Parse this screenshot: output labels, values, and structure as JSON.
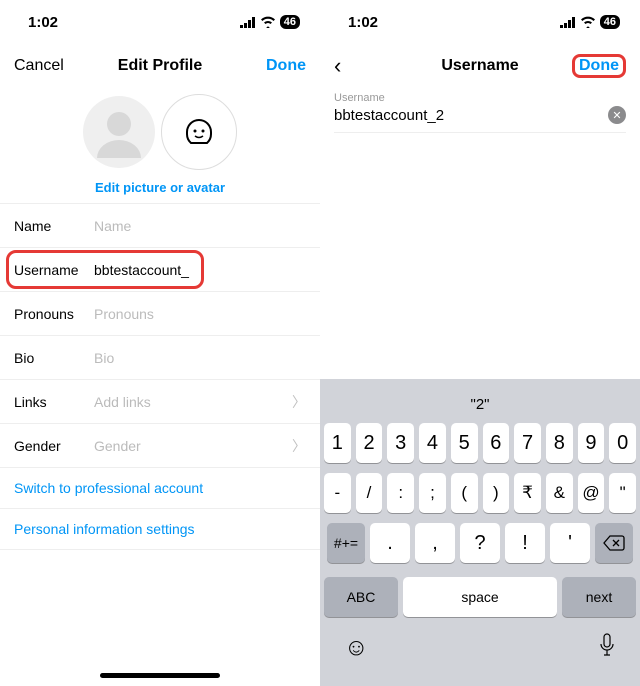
{
  "status": {
    "time": "1:02",
    "battery": "46"
  },
  "left": {
    "nav": {
      "cancel": "Cancel",
      "title": "Edit Profile",
      "done": "Done"
    },
    "editLink": "Edit picture or avatar",
    "rows": {
      "name": {
        "label": "Name",
        "placeholder": "Name"
      },
      "username": {
        "label": "Username",
        "value": "bbtestaccount_"
      },
      "pronouns": {
        "label": "Pronouns",
        "placeholder": "Pronouns"
      },
      "bio": {
        "label": "Bio",
        "placeholder": "Bio"
      },
      "links": {
        "label": "Links",
        "placeholder": "Add links"
      },
      "gender": {
        "label": "Gender",
        "placeholder": "Gender"
      }
    },
    "proLink": "Switch to professional account",
    "personalLink": "Personal information settings"
  },
  "right": {
    "nav": {
      "title": "Username",
      "done": "Done"
    },
    "field": {
      "label": "Username",
      "value": "bbtestaccount_2"
    },
    "keyboard": {
      "hint": "\"2\"",
      "r1": [
        "1",
        "2",
        "3",
        "4",
        "5",
        "6",
        "7",
        "8",
        "9",
        "0"
      ],
      "r2": [
        "-",
        "/",
        ":",
        ";",
        "(",
        ")",
        "₹",
        "&",
        "@",
        "\""
      ],
      "shiftKey": "#+=",
      "r3": [
        ".",
        ",",
        "?",
        "!",
        "'"
      ],
      "abc": "ABC",
      "space": "space",
      "next": "next"
    }
  }
}
